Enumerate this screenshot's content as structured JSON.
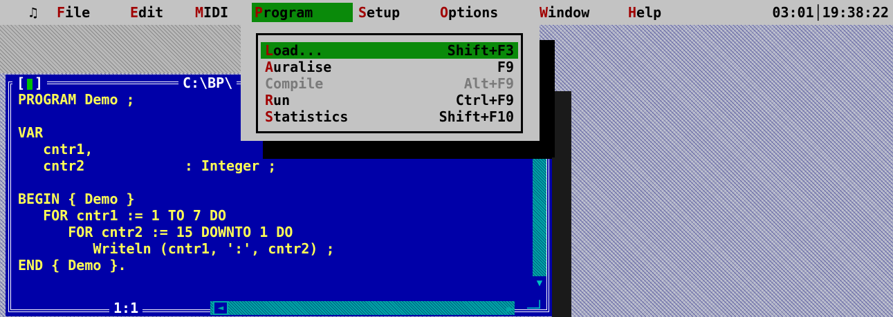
{
  "menubar": {
    "music_glyph": "♫",
    "items": [
      {
        "hotkey": "F",
        "rest": "ile"
      },
      {
        "hotkey": "E",
        "rest": "dit"
      },
      {
        "hotkey": "M",
        "rest": "IDI"
      },
      {
        "hotkey": "P",
        "rest": "rogram"
      },
      {
        "hotkey": "S",
        "rest": "etup"
      },
      {
        "hotkey": "O",
        "rest": "ptions"
      },
      {
        "hotkey": "W",
        "rest": "indow"
      },
      {
        "hotkey": "H",
        "rest": "elp"
      }
    ],
    "clock": "03:01│19:38:22"
  },
  "program_menu": {
    "items": [
      {
        "hotkey": "L",
        "rest": "oad...",
        "shortcut": "Shift+F3",
        "state": "selected"
      },
      {
        "hotkey": "A",
        "rest": "uralise",
        "shortcut": "F9",
        "state": "normal"
      },
      {
        "hotkey": "C",
        "rest": "ompile",
        "shortcut": "Alt+F9",
        "state": "disabled"
      },
      {
        "hotkey": "R",
        "rest": "un",
        "shortcut": "Ctrl+F9",
        "state": "normal"
      },
      {
        "hotkey": "S",
        "rest": "tatistics",
        "shortcut": "Shift+F10",
        "state": "normal"
      }
    ]
  },
  "editor": {
    "close_left": "[",
    "close_right": "]",
    "path": "C:\\BP\\",
    "position": "1:1",
    "code_lines": [
      "PROGRAM Demo ;",
      "",
      "VAR",
      "   cntr1,",
      "   cntr2            : Integer ;",
      "",
      "BEGIN { Demo }",
      "   FOR cntr1 := 1 TO 7 DO",
      "      FOR cntr2 := 15 DOWNTO 1 DO",
      "         Writeln (cntr1, ':', cntr2) ;",
      "END { Demo }."
    ],
    "scroll_up_glyph": "▲",
    "scroll_down_glyph": "▼",
    "scroll_left_glyph": "◄",
    "scroll_right_glyph": "►",
    "resize_glyph": "─┘"
  },
  "colors": {
    "menu_bg": "#c3c3c3",
    "menu_hotkey": "#a00000",
    "menu_selected": "#0a8a0a",
    "editor_bg": "#0000a8",
    "editor_text": "#ffff55",
    "scrollbar": "#00a8a8"
  }
}
